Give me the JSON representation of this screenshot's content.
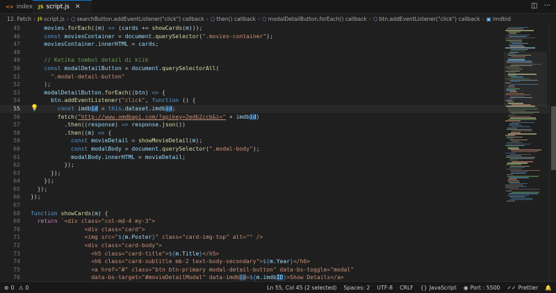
{
  "tabs": [
    {
      "label": "index.html",
      "icon": "<>",
      "active": false
    },
    {
      "label": "script.js",
      "icon": "JS",
      "active": true
    }
  ],
  "breadcrumb": [
    "12. Fetch",
    "script.js",
    "searchButton.addEventListener(\"click\") callback",
    "then() callback",
    "modalDetailButton.forEach() callback",
    "btn.addEventListener(\"click\") callback",
    "imdbid"
  ],
  "editor": {
    "line_numbers": [
      "45",
      "46",
      "47",
      "48",
      "49",
      "50",
      "51",
      "52",
      "53",
      "54",
      "55",
      "56",
      "57",
      "58",
      "59",
      "60",
      "61",
      "62",
      "63",
      "64",
      "65",
      "66",
      "67",
      "68",
      "69",
      "70",
      "71",
      "72",
      "73",
      "74",
      "75",
      "76",
      "77",
      "78"
    ],
    "current_line": "55"
  },
  "status": {
    "errors": "0",
    "warnings": "0",
    "position": "Ln 55, Col 45 (2 selected)",
    "spaces": "Spaces: 2",
    "encoding": "UTF-8",
    "eol": "CRLF",
    "language": "JavaScript",
    "port": "Port : 5500",
    "prettier": "Prettier"
  },
  "colors": {
    "accent": "#0078d4",
    "background": "#1f1f1f",
    "keyword": "#569cd6",
    "string": "#ce9178",
    "comment": "#6a9955",
    "variable": "#9cdcfe",
    "function": "#dcdcaa"
  }
}
